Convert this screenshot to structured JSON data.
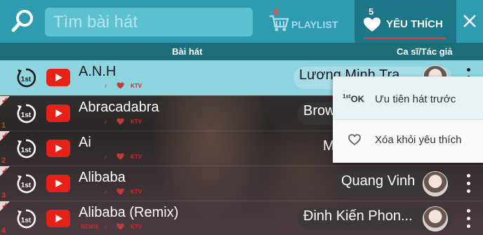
{
  "search": {
    "placeholder": "Tìm bài hát",
    "value": ""
  },
  "tabs": {
    "playlist": {
      "badge": "4",
      "label": "PLAYLIST"
    },
    "favorites": {
      "badge": "5",
      "label": "YÊU THÍCH"
    }
  },
  "columns": {
    "song": "Bài hát",
    "artist": "Ca sĩ/Tác giả"
  },
  "songs": [
    {
      "title": "A.N.H",
      "artist": "Lương Minh Tra",
      "meta": "KTV",
      "num": "",
      "checked": false,
      "selected": true
    },
    {
      "title": "Abracadabra",
      "artist": "Brow",
      "meta": "KTV",
      "num": "1",
      "checked": true,
      "selected": false
    },
    {
      "title": "Ai",
      "artist": "M",
      "meta": "KTV",
      "num": "2",
      "checked": true,
      "selected": false
    },
    {
      "title": "Alibaba",
      "artist": "Quang Vinh",
      "meta": "KTV",
      "num": "3",
      "checked": true,
      "selected": false
    },
    {
      "title": "Alibaba (Remix)",
      "artist": "Đinh Kiến Phon...",
      "meta": "KTV",
      "tag": "REMIX",
      "num": "4",
      "checked": true,
      "selected": false
    }
  ],
  "context_menu": {
    "priority": {
      "icon_text": "OK",
      "icon_sup": "1st",
      "label": "Ưu tiên hát trước"
    },
    "remove": {
      "label": "Xóa khỏi yêu thích"
    }
  },
  "colors": {
    "topbar": "#2f9bb0",
    "active_tab": "#1d7688",
    "badge_red": "#ff4a3d",
    "selected_row": "#8fd5e0"
  }
}
